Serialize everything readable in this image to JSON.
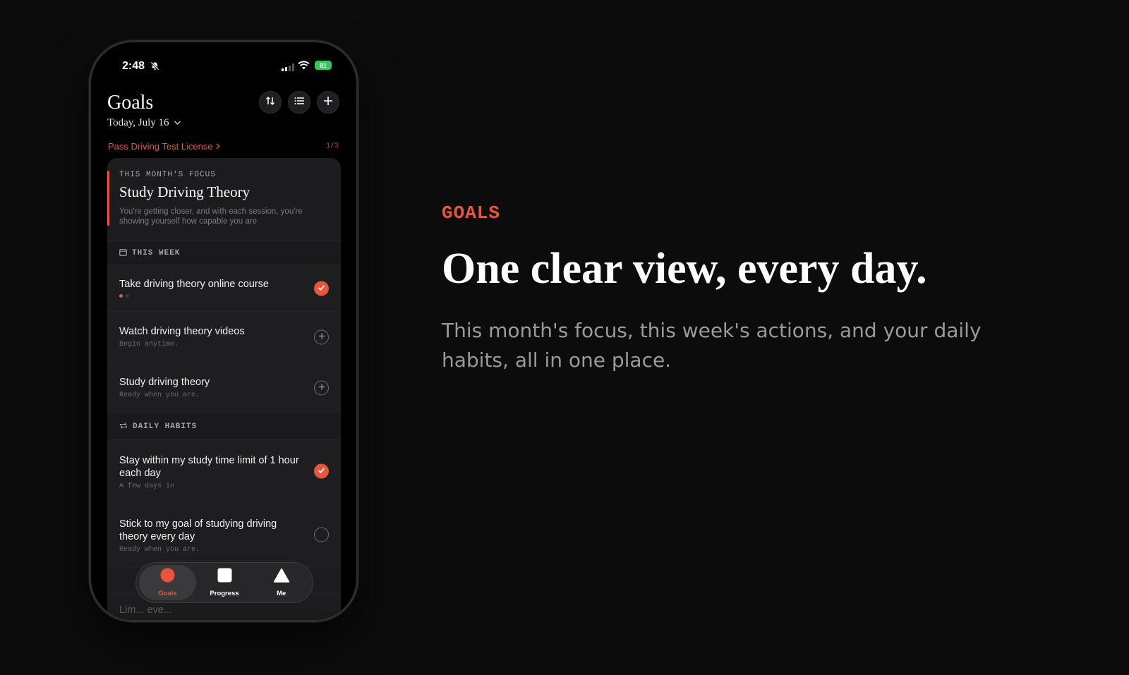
{
  "phone": {
    "status": {
      "time": "2:48",
      "battery": "81"
    },
    "header": {
      "title": "Goals",
      "date": "Today, July 16"
    },
    "goal": {
      "name": "Pass Driving Test License",
      "count": "1/3"
    },
    "focus": {
      "kicker": "THIS MONTH'S FOCUS",
      "title": "Study Driving Theory",
      "description": "You're getting closer, and with each session, you're showing yourself how capable you are"
    },
    "week": {
      "label": "THIS WEEK",
      "items": [
        {
          "title": "Take driving theory online course",
          "subtitle": "",
          "state": "done"
        },
        {
          "title": "Watch driving theory videos",
          "subtitle": "Begin anytime.",
          "state": "add"
        },
        {
          "title": "Study driving theory",
          "subtitle": "Ready when you are.",
          "state": "add"
        }
      ]
    },
    "habits": {
      "label": "DAILY HABITS",
      "items": [
        {
          "title": "Stay within my study time limit of 1 hour each day",
          "subtitle": "A few days in",
          "state": "done"
        },
        {
          "title": "Stick to my goal of studying driving theory every day",
          "subtitle": "Ready when you are.",
          "state": "empty"
        }
      ],
      "partial_item": "Lim... eve..."
    },
    "tabs": [
      {
        "label": "Goals",
        "active": true
      },
      {
        "label": "Progress",
        "active": false
      },
      {
        "label": "Me",
        "active": false
      }
    ]
  },
  "marketing": {
    "eyebrow": "GOALS",
    "headline": "One clear view, every day.",
    "subhead": "This month's focus, this week's actions, and your daily habits, all in one place."
  },
  "colors": {
    "accent": "#e8553a",
    "background": "#0c0c0d",
    "card": "#1c1c1e"
  }
}
